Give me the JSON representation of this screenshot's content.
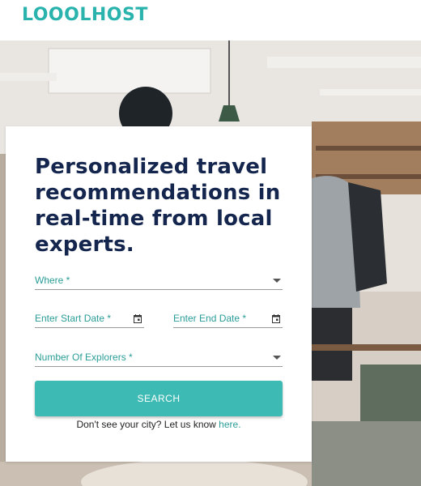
{
  "brand": {
    "name": "LOOOLHOST",
    "color": "#2ab3ad"
  },
  "hero": {
    "heading": "Personalized travel recommendations in real-time from local experts."
  },
  "form": {
    "where_label": "Where *",
    "start_date_label": "Enter Start Date *",
    "end_date_label": "Enter End Date *",
    "explorers_label": "Number Of Explorers *",
    "search_label": "SEARCH"
  },
  "footer": {
    "note": "Don't see your city? Let us know ",
    "link": "here."
  },
  "icons": {
    "dropdown": "chevron-down-icon",
    "calendar": "calendar-icon",
    "logo_mark": "magnifier-icon"
  },
  "colors": {
    "accent": "#3dbab3",
    "heading": "#14254e",
    "label": "#2a9d97"
  }
}
